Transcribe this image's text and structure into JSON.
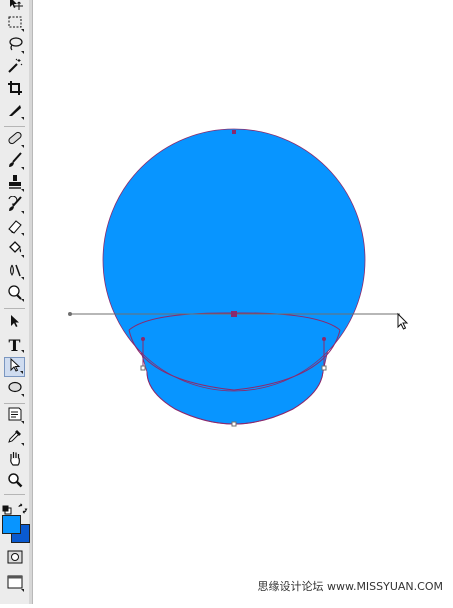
{
  "toolbar": {
    "tools": [
      {
        "name": "move-tool-icon"
      },
      {
        "name": "marquee-tool-icon"
      },
      {
        "name": "lasso-tool-icon"
      },
      {
        "name": "magic-wand-tool-icon"
      },
      {
        "name": "crop-tool-icon"
      },
      {
        "name": "slice-tool-icon"
      },
      {
        "name": "healing-brush-tool-icon"
      },
      {
        "name": "brush-tool-icon"
      },
      {
        "name": "clone-stamp-tool-icon"
      },
      {
        "name": "history-brush-tool-icon"
      },
      {
        "name": "eraser-tool-icon"
      },
      {
        "name": "paint-bucket-tool-icon"
      },
      {
        "name": "blur-tool-icon"
      },
      {
        "name": "dodge-tool-icon"
      },
      {
        "name": "path-selection-tool-icon"
      },
      {
        "name": "type-tool-icon"
      },
      {
        "name": "direct-selection-tool-icon",
        "selected": true
      },
      {
        "name": "ellipse-shape-tool-icon"
      },
      {
        "name": "notes-tool-icon"
      },
      {
        "name": "eyedropper-tool-icon"
      },
      {
        "name": "hand-tool-icon"
      },
      {
        "name": "zoom-tool-icon"
      }
    ],
    "type_glyph": "T",
    "foreground_color": "#0895ff",
    "background_color": "#0a5ad0"
  },
  "canvas": {
    "shape_fill": "#0895ff",
    "path_color": "#8a2a6e",
    "guide_color": "#6f6f6f"
  },
  "watermark": "思缘设计论坛  www.MISSYUAN.COM"
}
